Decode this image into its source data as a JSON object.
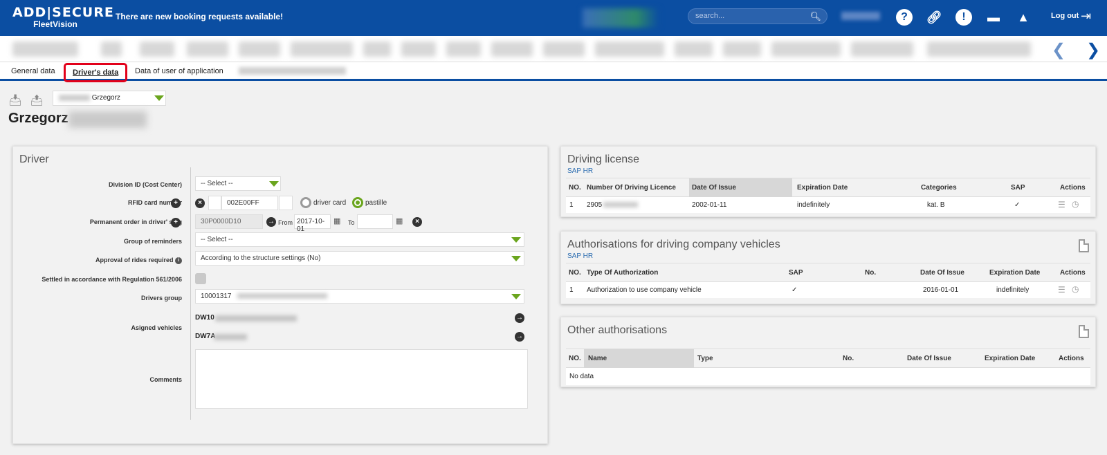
{
  "topbar": {
    "logo_line1": "ADD|SECURE",
    "logo_line2": "FleetVision",
    "notice": "There are new booking requests available!",
    "search_placeholder": "search...",
    "logout_label": "Log out",
    "icons": [
      "question-circle-icon",
      "link-icon",
      "exclamation-circle-icon",
      "chat-bubble-icon",
      "chevron-up-icon",
      "logout-icon"
    ]
  },
  "tabs": {
    "general": "General data",
    "driver": "Driver's data",
    "userapp": "Data of user of application"
  },
  "header": {
    "selected_driver": "Grzegorz",
    "title": "Grzegorz"
  },
  "driver_panel": {
    "title": "Driver",
    "labels": {
      "division": "Division ID (Cost Center)",
      "rfid": "RFID card number",
      "permanent": "Permanent order in driver' slog",
      "reminders": "Group of reminders",
      "approval": "Approval of rides required",
      "settled": "Settled in accordance with Regulation 561/2006",
      "drivers_group": "Drivers group",
      "vehicles": "Asigned vehicles",
      "comments": "Comments"
    },
    "division_value": "-- Select --",
    "rfid_value": "002E00FF",
    "rfid_options": [
      "driver card",
      "pastille"
    ],
    "rfid_selected": "pastille",
    "permanent_value": "30P0000D10",
    "from_label": "From",
    "from_value": "2017-10-01",
    "to_label": "To",
    "to_value": "",
    "reminders_value": "-- Select --",
    "approval_value": "According to the structure settings (No)",
    "settled_checked": false,
    "drivers_group_value": "10001317",
    "vehicles": [
      "DW10",
      "DW7A"
    ],
    "comments_value": ""
  },
  "driving_license": {
    "title": "Driving license",
    "source": "SAP HR",
    "columns": [
      "NO.",
      "Number Of Driving Licence",
      "Date Of Issue",
      "Expiration Date",
      "Categories",
      "SAP",
      "Actions"
    ],
    "rows": [
      {
        "no": "1",
        "number": "2905",
        "date_of_issue": "2002-01-11",
        "expiration": "indefinitely",
        "categories": "kat. B",
        "sap": "✓"
      }
    ]
  },
  "authorisations": {
    "title": "Authorisations for driving company vehicles",
    "source": "SAP HR",
    "columns": [
      "NO.",
      "Type Of Authorization",
      "SAP",
      "No.",
      "Date Of Issue",
      "Expiration Date",
      "Actions"
    ],
    "rows": [
      {
        "no": "1",
        "type": "Authorization to use company vehicle",
        "sap": "✓",
        "number": "",
        "date_of_issue": "2016-01-01",
        "expiration": "indefinitely"
      }
    ]
  },
  "other_authorisations": {
    "title": "Other authorisations",
    "columns": [
      "NO.",
      "Name",
      "Type",
      "No.",
      "Date Of Issue",
      "Expiration Date",
      "Actions"
    ],
    "empty_text": "No data"
  },
  "colors": {
    "brand_blue": "#0b4ea2",
    "accent_green": "#6aa51d",
    "highlight_red": "#e2001a"
  }
}
